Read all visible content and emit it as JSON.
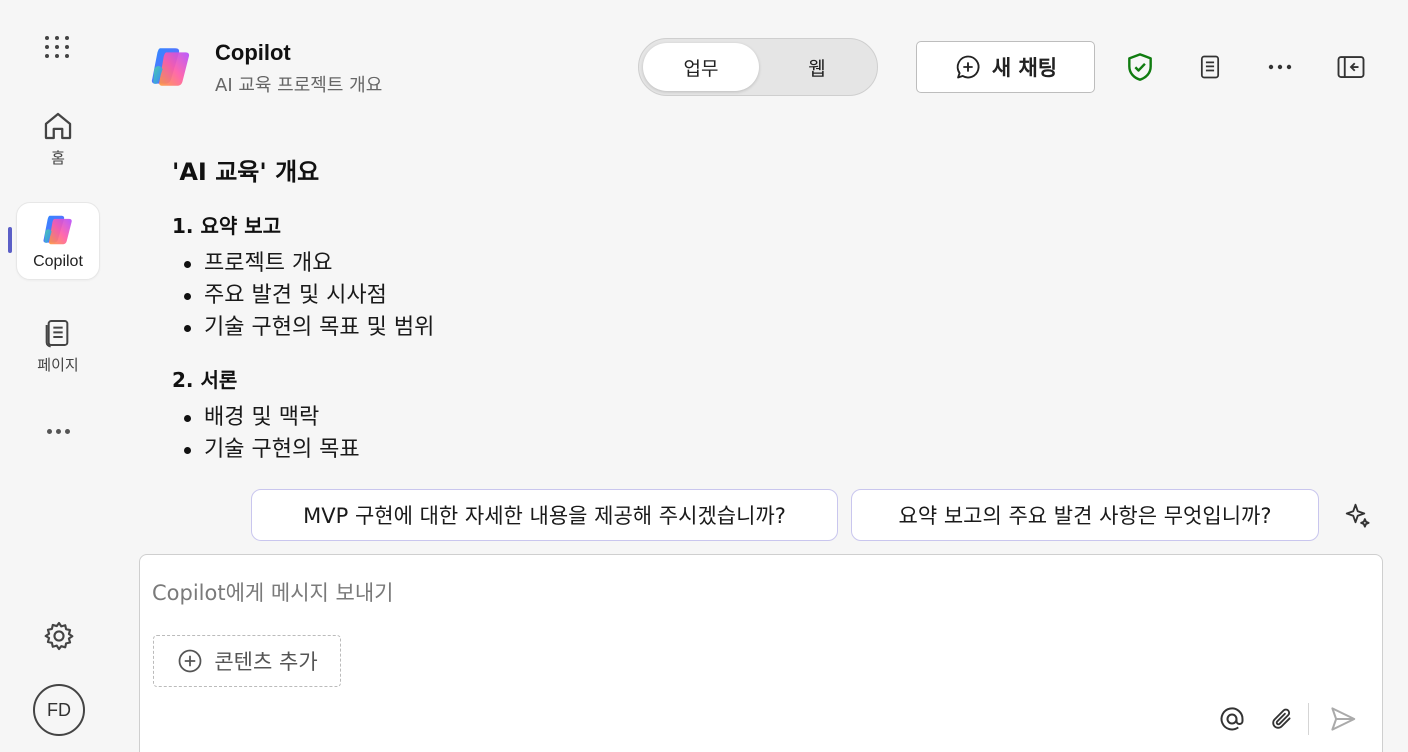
{
  "rail": {
    "home_label": "홈",
    "copilot_label": "Copilot",
    "pages_label": "페이지",
    "avatar_initials": "FD"
  },
  "header": {
    "title": "Copilot",
    "subtitle": "AI 교육 프로젝트 개요",
    "mode_toggle": {
      "active": "업무",
      "inactive": "웹"
    },
    "new_chat_label": "새 채팅"
  },
  "content": {
    "heading": "'AI 교육' 개요",
    "sections": [
      {
        "title": "1. 요약 보고",
        "items": [
          "프로젝트 개요",
          "주요 발견 및 시사점",
          "기술 구현의 목표 및 범위"
        ]
      },
      {
        "title": "2. 서론",
        "items": [
          "배경 및 맥락",
          "기술 구현의 목표"
        ]
      }
    ]
  },
  "suggestions": [
    "MVP 구현에 대한 자세한 내용을 제공해 주시겠습니까?",
    "요약 보고의 주요 발견 사항은 무엇입니까?"
  ],
  "composer": {
    "placeholder": "Copilot에게 메시지 보내기",
    "add_content_label": "콘텐츠 추가"
  },
  "colors": {
    "accent": "#5b5fc7",
    "shield_green": "#107c10",
    "suggest_border": "#c9c6ee"
  }
}
